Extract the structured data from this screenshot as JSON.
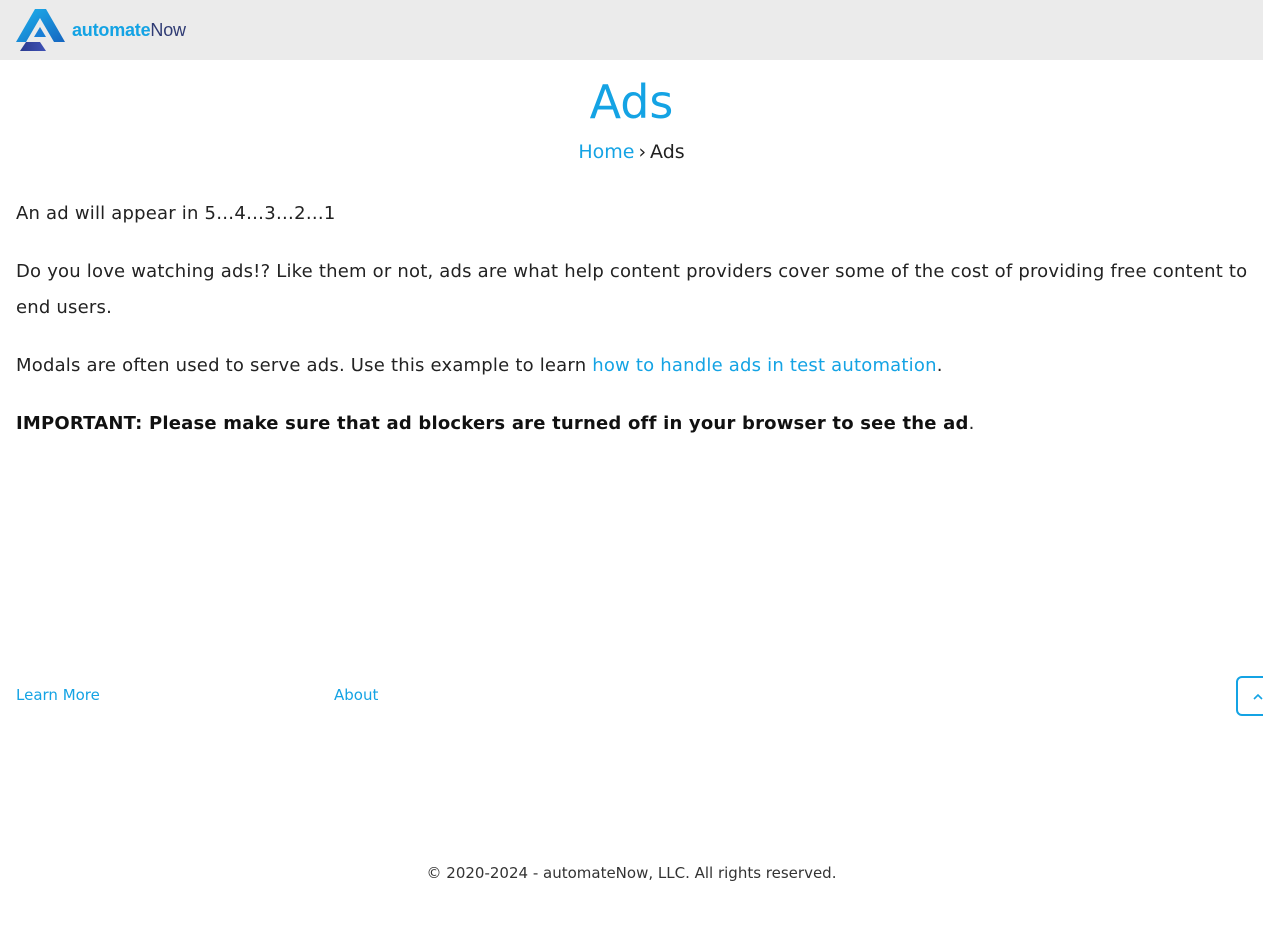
{
  "header": {
    "logo": {
      "icon": "automatenow-logo-icon",
      "text_part1": "automate",
      "text_part2": "Now",
      "colors": {
        "primary": "#14a3e4",
        "secondary": "#2f3b74"
      }
    }
  },
  "page": {
    "title": "Ads",
    "breadcrumb": {
      "home": "Home",
      "separator": "›",
      "current": "Ads"
    }
  },
  "content": {
    "countdown": "An ad will appear in 5…4…3…2…1",
    "intro": "Do you love watching ads!? Like them or not, ads are what help content providers cover some of the cost of providing free content to end users.",
    "modals_prefix": "Modals are often used to serve ads. Use this example to learn ",
    "modals_link": "how to handle ads in test automation",
    "modals_suffix": ".",
    "important": "IMPORTANT: Please make sure that ad blockers are turned off in your browser to see the ad",
    "important_suffix": "."
  },
  "footer": {
    "learn_more": "Learn More",
    "about": "About",
    "scroll_top_icon": "chevron-up-icon",
    "copyright": "© 2020-2024 - automateNow, LLC. All rights reserved."
  },
  "theme": {
    "accent": "#14a3e4",
    "header_bg": "#ebebeb"
  }
}
